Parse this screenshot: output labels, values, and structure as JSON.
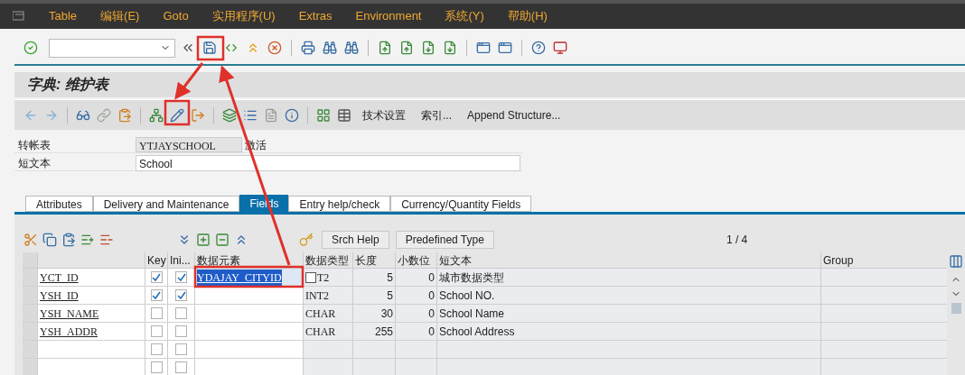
{
  "menu": [
    {
      "label": "Table"
    },
    {
      "label": "编辑(E)"
    },
    {
      "label": "Goto"
    },
    {
      "label": "实用程序(U)"
    },
    {
      "label": "Extras"
    },
    {
      "label": "Environment"
    },
    {
      "label": "系统(Y)"
    },
    {
      "label": "帮助(H)"
    }
  ],
  "title": "字典: 维护表",
  "app_toolbar": {
    "buttons": [
      "技术设置",
      "索引...",
      "Append Structure..."
    ]
  },
  "form": [
    {
      "label": "转帐表",
      "value": "YTJAYSCHOOL",
      "readonly": true,
      "status": "激活"
    },
    {
      "label": "短文本",
      "value": "School",
      "readonly": false
    }
  ],
  "tabs": [
    {
      "label": "Attributes",
      "selected": false
    },
    {
      "label": "Delivery and Maintenance",
      "selected": false
    },
    {
      "label": "Fields",
      "selected": true
    },
    {
      "label": "Entry help/check",
      "selected": false
    },
    {
      "label": "Currency/Quantity Fields",
      "selected": false
    }
  ],
  "table_toolbar": {
    "buttons": [
      "Srch Help",
      "Predefined Type"
    ],
    "page": "1 / 4"
  },
  "table": {
    "columns": [
      "Key",
      "Ini...",
      "数据元素",
      "数据类型",
      "长度",
      "小数位",
      "短文本",
      "Group"
    ],
    "rows": [
      {
        "field": "YCT_ID",
        "key": true,
        "initial": true,
        "data_element": "YDAJAY_CITYID",
        "editing": true,
        "data_type": "T2",
        "length": "5",
        "decimals": "0",
        "short_text": "城市数据类型"
      },
      {
        "field": "YSH_ID",
        "key": true,
        "initial": true,
        "editing": false,
        "data_type": "INT2",
        "length": "5",
        "decimals": "0",
        "short_text": "School NO."
      },
      {
        "field": "YSH_NAME",
        "key": false,
        "initial": false,
        "editing": false,
        "data_type": "CHAR",
        "length": "30",
        "decimals": "0",
        "short_text": "School Name"
      },
      {
        "field": "YSH_ADDR",
        "key": false,
        "initial": false,
        "editing": false,
        "data_type": "CHAR",
        "length": "255",
        "decimals": "0",
        "short_text": "School Address"
      },
      {
        "key": false,
        "initial": false,
        "editing": false
      },
      {
        "key": false,
        "initial": false,
        "editing": false
      }
    ]
  }
}
